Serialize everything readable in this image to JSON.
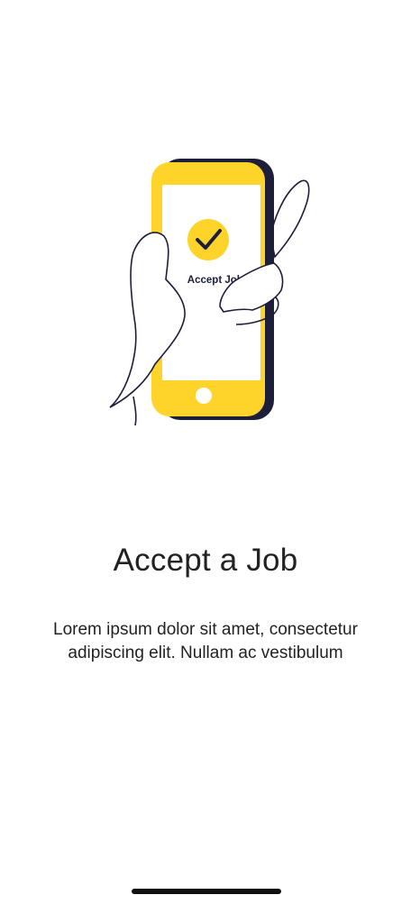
{
  "illustration": {
    "screen_label": "Accept Jobs",
    "accent_color": "#FFD42A",
    "phone_shadow_color": "#1C1E3A",
    "check_icon": "check-icon"
  },
  "onboarding": {
    "title": "Accept a Job",
    "description": "Lorem ipsum dolor sit amet, consectetur adipiscing elit. Nullam ac vestibulum"
  },
  "system": {
    "home_indicator": "home-indicator"
  }
}
